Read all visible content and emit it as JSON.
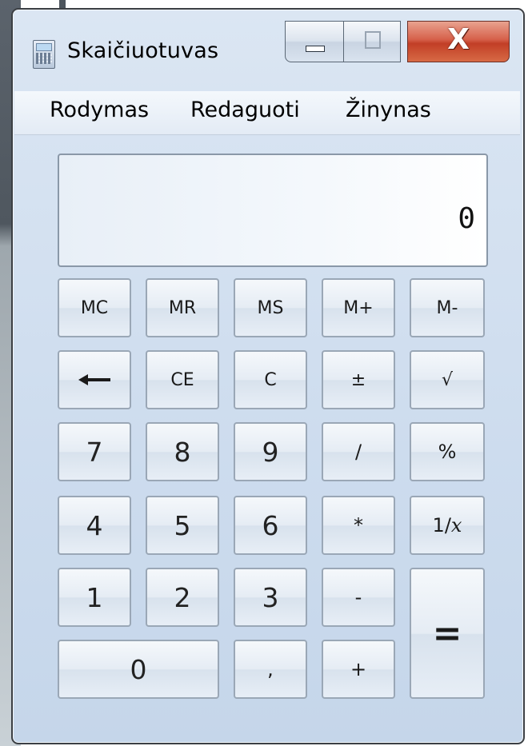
{
  "window": {
    "title": "Skaičiuotuvas",
    "controls": {
      "minimize_icon": "minimize-icon",
      "maximize_icon": "maximize-icon",
      "close_label": "X"
    }
  },
  "menu": {
    "items": [
      "Rodymas",
      "Redaguoti",
      "Žinynas"
    ]
  },
  "display": {
    "value": "0"
  },
  "keys": {
    "mc": "MC",
    "mr": "MR",
    "ms": "MS",
    "mplus": "M+",
    "mminus": "M-",
    "backspace_icon": "backspace-arrow-icon",
    "ce": "CE",
    "c": "C",
    "plusminus": "±",
    "sqrt": "√",
    "d7": "7",
    "d8": "8",
    "d9": "9",
    "divide": "/",
    "percent": "%",
    "d4": "4",
    "d5": "5",
    "d6": "6",
    "multiply": "*",
    "reciprocal_prefix": "1/",
    "reciprocal_var": "x",
    "d1": "1",
    "d2": "2",
    "d3": "3",
    "minus": "-",
    "equals": "=",
    "d0": "0",
    "decimal": ",",
    "plus": "+"
  },
  "colors": {
    "close_button": "#c94b32",
    "window_bg": "#d6e2f0"
  }
}
